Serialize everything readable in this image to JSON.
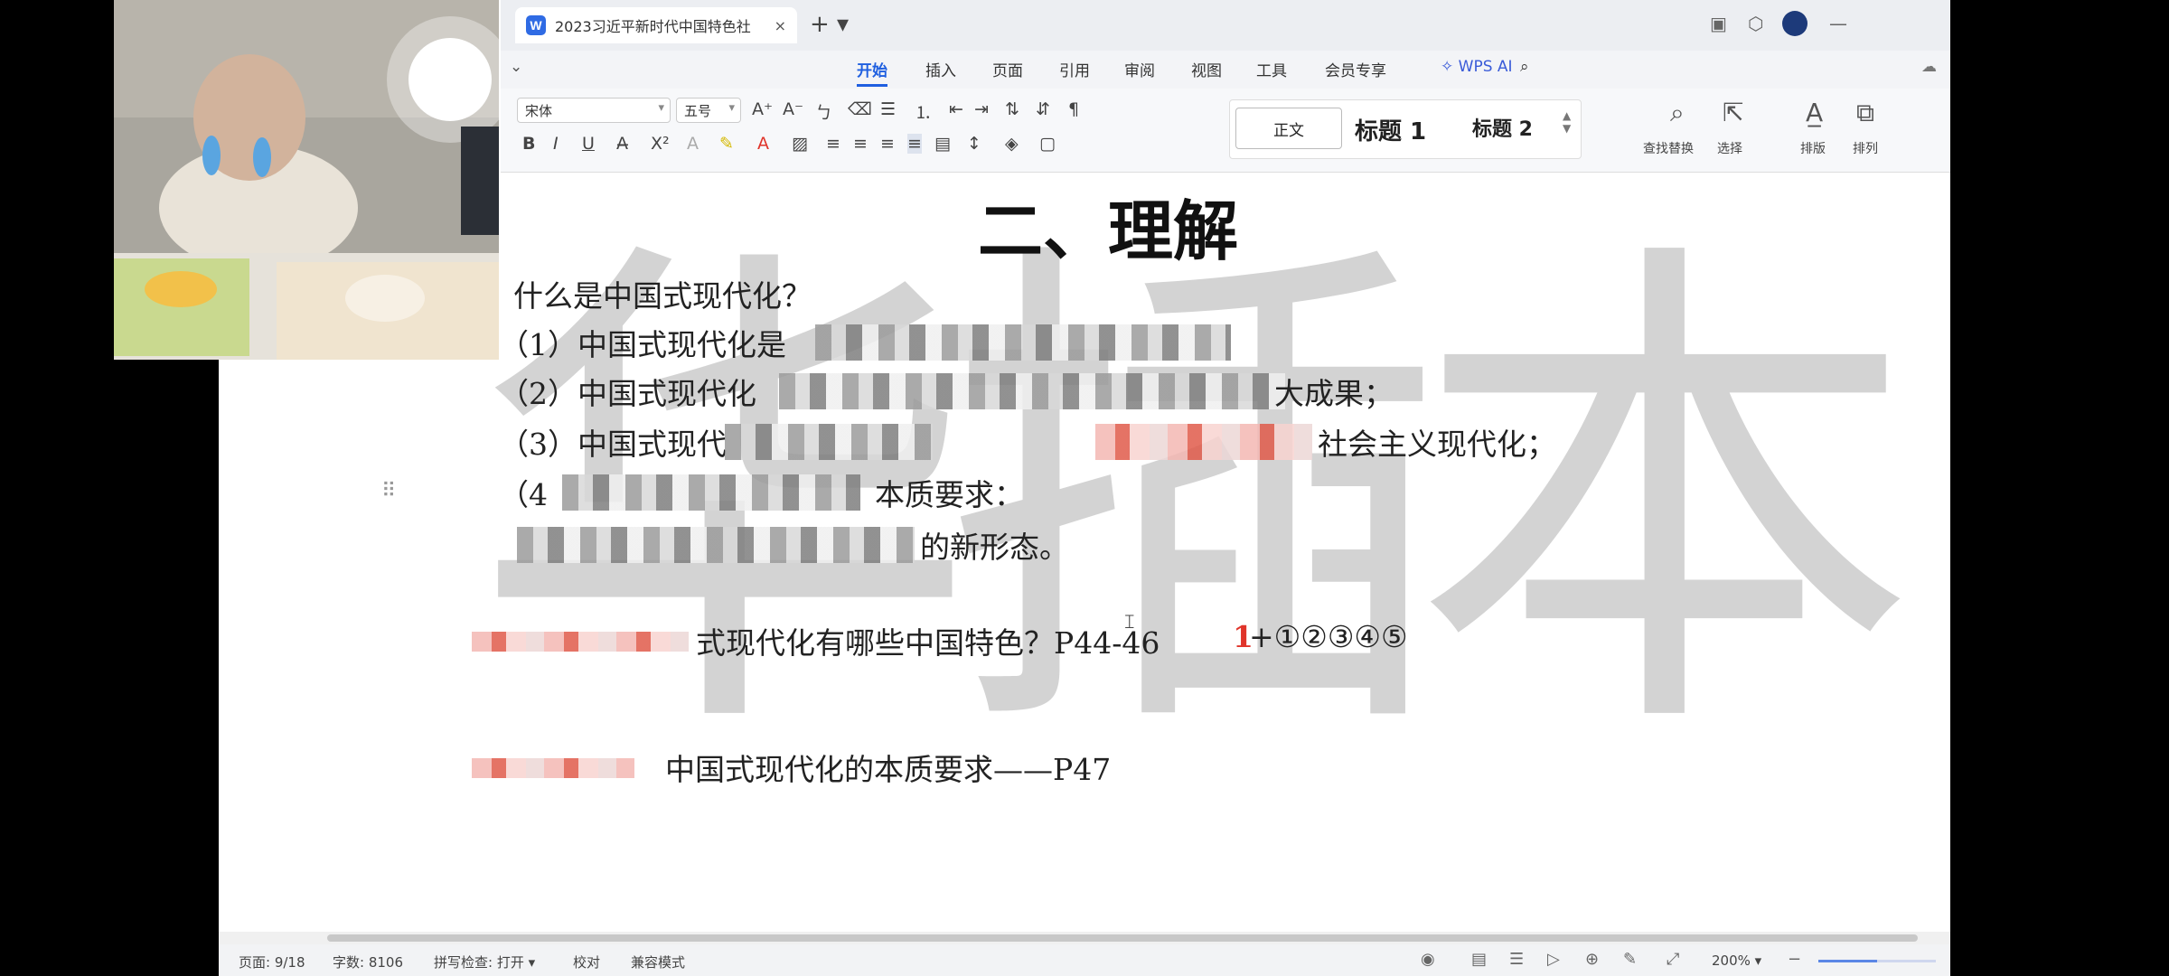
{
  "tab": {
    "title": "2023习近平新时代中国特色社",
    "close": "×",
    "app_badge": "W"
  },
  "titlebar": {
    "new_tab": "+ ▾",
    "minimize": "—"
  },
  "menu": [
    "开始",
    "插入",
    "页面",
    "引用",
    "审阅",
    "视图",
    "工具",
    "会员专享",
    "WPS AI"
  ],
  "menu_active_index": 0,
  "ribbon": {
    "font_name": "宋体",
    "font_size": "五号",
    "styles": [
      "正文",
      "标题 1",
      "标题 2"
    ],
    "tools": [
      "查找替换",
      "选择",
      "排版",
      "排列"
    ]
  },
  "document": {
    "heading": "二、理解",
    "lines": [
      "什么是中国式现代化？",
      "（1）中国式现代化是",
      "（2）中国式现代化",
      "大成果；",
      "（3）中国式现代",
      "社会主义现代化；",
      "（4",
      "本质要求：",
      "的新形态。",
      "式现代化有哪些中国特色？P44-46",
      "1",
      "+①②③④⑤",
      "中国式现代化的本质要求——P47"
    ],
    "watermark": "华插本"
  },
  "status": {
    "page": "页面: 9/18",
    "words": "字数: 8106",
    "spell": "拼写检查: 打开 ▾",
    "proof": "校对",
    "compat": "兼容模式",
    "zoom": "200% ▾",
    "zoom_fraction": 0.5
  },
  "colors": {
    "accent": "#1f5fe0",
    "red_number": "#e0342a"
  }
}
